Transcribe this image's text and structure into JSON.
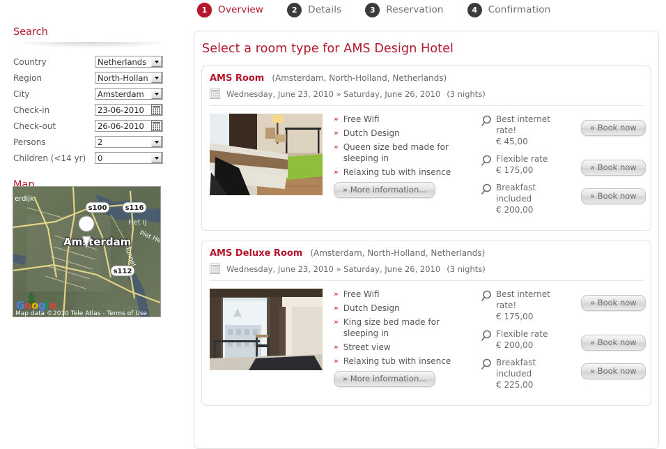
{
  "steps": [
    {
      "num": "1",
      "label": "Overview",
      "state": "active"
    },
    {
      "num": "2",
      "label": "Details",
      "state": "inactive"
    },
    {
      "num": "3",
      "label": "Reservation",
      "state": "inactive"
    },
    {
      "num": "4",
      "label": "Confirmation",
      "state": "inactive"
    }
  ],
  "sidebar": {
    "search_heading": "Search",
    "map_heading": "Map",
    "fields": [
      {
        "label": "Country",
        "value": "Netherlands",
        "type": "select"
      },
      {
        "label": "Region",
        "value": "North-Hollan",
        "type": "select"
      },
      {
        "label": "City",
        "value": "Amsterdam",
        "type": "select"
      },
      {
        "label": "Check-in",
        "value": "23-06-2010",
        "type": "date"
      },
      {
        "label": "Check-out",
        "value": "26-06-2010",
        "type": "date"
      },
      {
        "label": "Persons",
        "value": "2",
        "type": "select"
      },
      {
        "label": "Children (<14 yr)",
        "value": "0",
        "type": "select"
      }
    ],
    "map": {
      "city_label": "Amsterdam",
      "labels": [
        "erdijk",
        "s100",
        "s116",
        "s112",
        "Het IJ",
        "Piet He",
        "IJ-Tunnel"
      ],
      "brand": "Google",
      "attribution": "Map data ©2010 Tele Atlas - Terms of Use"
    }
  },
  "main": {
    "title": "Select a room type for AMS Design Hotel",
    "more_info_label": "» More information...",
    "book_now_label": "» Book now",
    "rooms": [
      {
        "name": "AMS Room",
        "location": "(Amsterdam, North-Holland, Netherlands)",
        "date_range": "Wednesday, June 23, 2010 » Saturday, June 26, 2010",
        "nights": "(3 nights)",
        "features": [
          "Free Wifi",
          "Dutch Design",
          "Queen size bed made for sleeping in",
          "Relaxing tub with insence"
        ],
        "rates": [
          {
            "name": "Best internet rate!",
            "price": "€ 45,00"
          },
          {
            "name": "Flexible rate",
            "price": "€ 175,00"
          },
          {
            "name": "Breakfast included",
            "price": "€ 200,00"
          }
        ]
      },
      {
        "name": "AMS Deluxe Room",
        "location": "(Amsterdam, North-Holland, Netherlands)",
        "date_range": "Wednesday, June 23, 2010 » Saturday, June 26, 2010",
        "nights": "(3 nights)",
        "features": [
          "Free Wifi",
          "Dutch Design",
          "King size bed made for sleeping in",
          "Street view",
          "Relaxing tub with insence"
        ],
        "rates": [
          {
            "name": "Best internet rate!",
            "price": "€ 175,00"
          },
          {
            "name": "Flexible rate",
            "price": "€ 200,00"
          },
          {
            "name": "Breakfast included",
            "price": "€ 225,00"
          }
        ]
      }
    ]
  },
  "colors": {
    "accent": "#b4162c",
    "text": "#555555",
    "step_inactive": "#3b3b3b"
  }
}
